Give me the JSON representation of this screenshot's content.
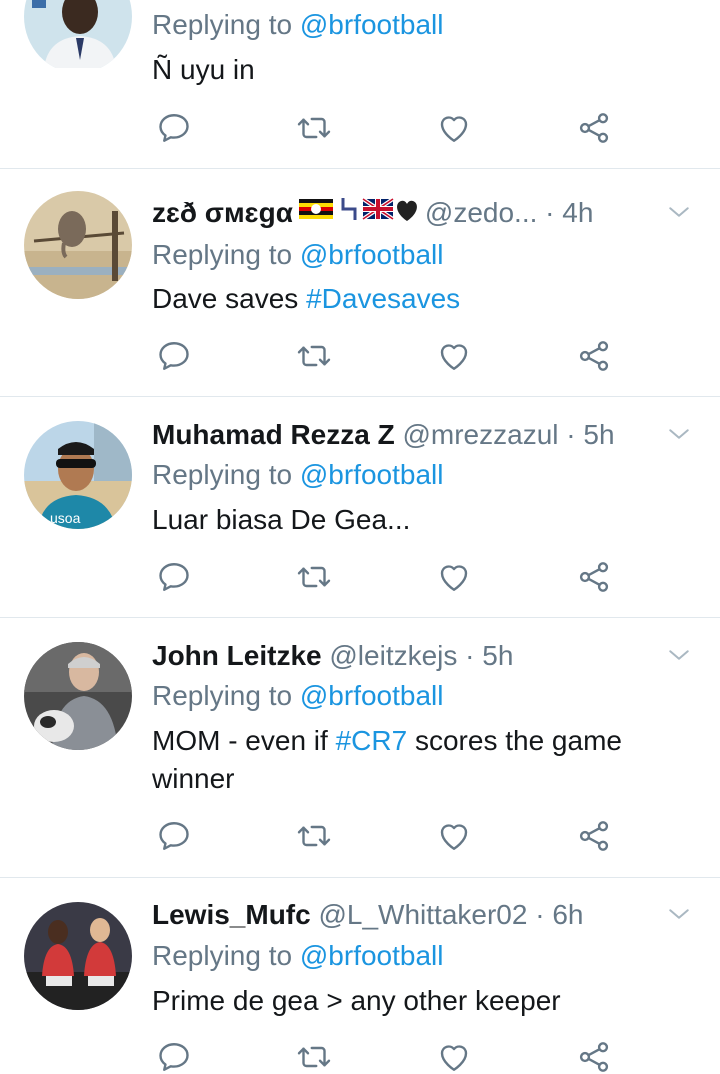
{
  "colors": {
    "link": "#1b95e0",
    "secondary": "#657786",
    "primary": "#14171a",
    "divider": "#e1e8ed"
  },
  "icons": [
    "reply-icon",
    "retweet-icon",
    "like-icon",
    "share-icon",
    "chevron-down-icon"
  ],
  "tweets": [
    {
      "replying_prefix": "Replying to",
      "replying_to": "@brfootball",
      "text": "Ñ uyu in"
    },
    {
      "name": "zɛð σмɛgα",
      "handle": "@zedo...",
      "sep": "·",
      "time": "4h",
      "replying_prefix": "Replying to",
      "replying_to": "@brfootball",
      "text_plain": "Dave saves",
      "hashtag": "#Davesaves"
    },
    {
      "name": "Muhamad Rezza Z",
      "handle": "@mrezzazul",
      "sep": "·",
      "time": "5h",
      "replying_prefix": "Replying to",
      "replying_to": "@brfootball",
      "text": "Luar biasa De Gea..."
    },
    {
      "name": "John Leitzke",
      "handle": "@leitzkejs",
      "sep": "·",
      "time": "5h",
      "replying_prefix": "Replying to",
      "replying_to": "@brfootball",
      "text_before": "MOM - even if",
      "hashtag": "#CR7",
      "text_after": "scores the game winner"
    },
    {
      "name": "Lewis_Mufc",
      "handle": "@L_Whittaker02",
      "sep": "·",
      "time": "6h",
      "replying_prefix": "Replying to",
      "replying_to": "@brfootball",
      "text": "Prime de gea > any other keeper"
    }
  ]
}
